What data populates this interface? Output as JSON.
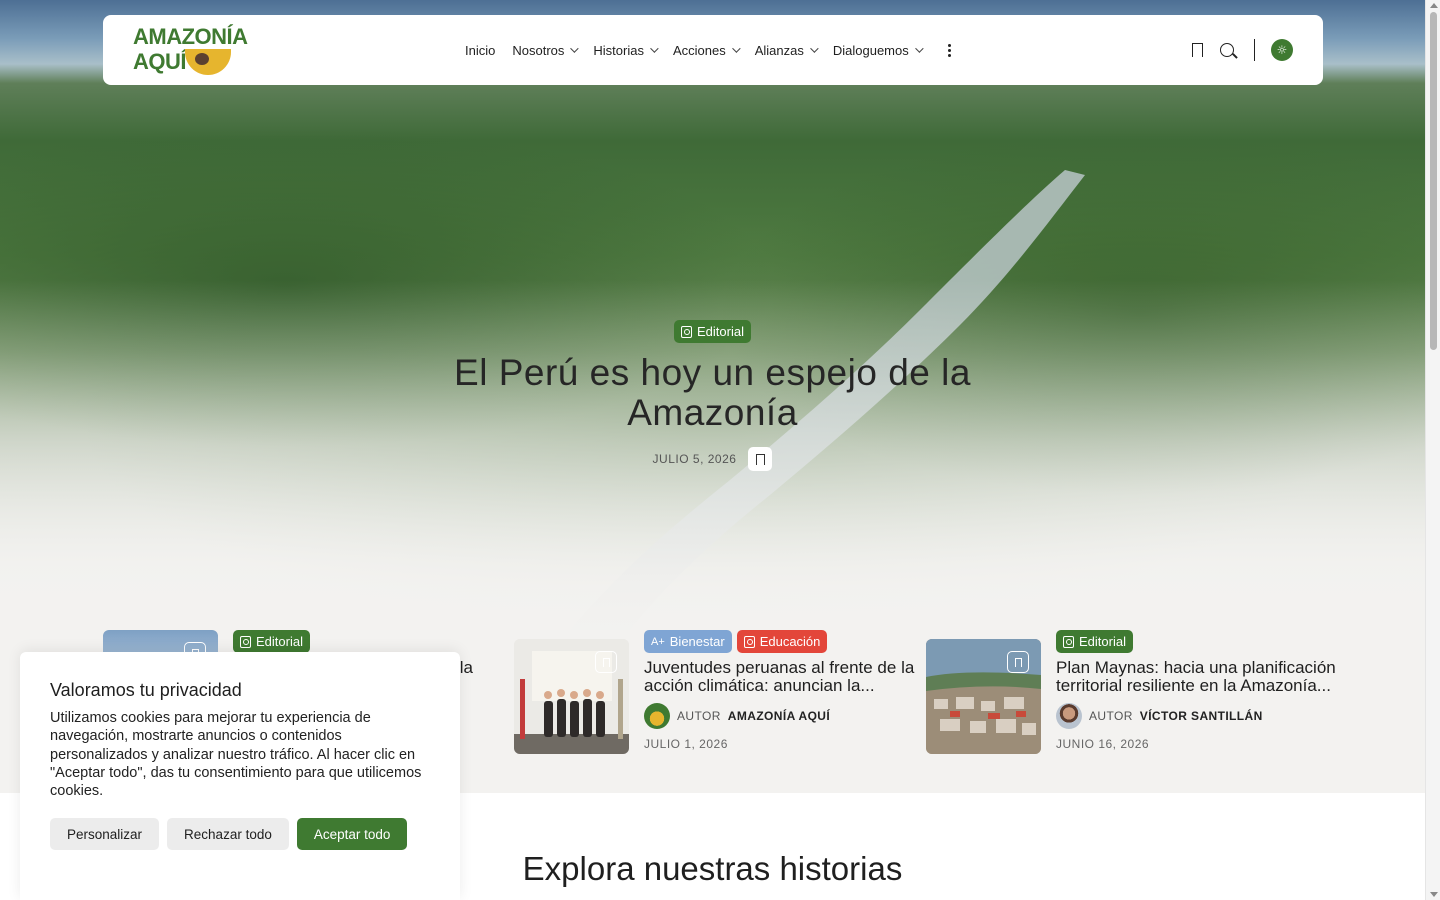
{
  "nav": {
    "logo_line1": "AMAZONÍA",
    "logo_line2": "AQUÍ",
    "items": [
      {
        "label": "Inicio",
        "has_dropdown": false
      },
      {
        "label": "Nosotros",
        "has_dropdown": true
      },
      {
        "label": "Historias",
        "has_dropdown": true
      },
      {
        "label": "Acciones",
        "has_dropdown": true
      },
      {
        "label": "Alianzas",
        "has_dropdown": true
      },
      {
        "label": "Dialoguemos",
        "has_dropdown": true
      }
    ],
    "icons": [
      "more-vertical-icon",
      "bookmark-icon",
      "search-icon",
      "sun-icon"
    ]
  },
  "hero": {
    "category": "Editorial",
    "title": "El Perú es hoy un espejo de la Amazonía",
    "date": "JULIO 5, 2026"
  },
  "cards": [
    {
      "tags": [
        {
          "label": "Editorial",
          "color": "#3f7a31"
        }
      ],
      "title_visible": "la"
    },
    {
      "tags": [
        {
          "label": "Bienestar",
          "color": "#7fa5d4"
        },
        {
          "label": "Educación",
          "color": "#e3463a"
        }
      ],
      "title": "Juventudes peruanas al frente de la acción climática: anuncian la...",
      "author_prefix": "AUTOR",
      "author": "AMAZONÍA AQUÍ",
      "date": "JULIO 1, 2026"
    },
    {
      "tags": [
        {
          "label": "Editorial",
          "color": "#3f7a31"
        }
      ],
      "title": "Plan Maynas: hacia una planificación territorial resiliente en la Amazonía...",
      "author_prefix": "AUTOR",
      "author": "VÍCTOR SANTILLÁN",
      "date": "JUNIO 16, 2026"
    }
  ],
  "section": {
    "title": "Explora nuestras historias"
  },
  "cookie": {
    "title": "Valoramos tu privacidad",
    "text": "Utilizamos cookies para mejorar tu experiencia de navegación, mostrarte anuncios o contenidos personalizados y analizar nuestro tráfico. Al hacer clic en \"Aceptar todo\", das tu consentimiento para que utilicemos cookies.",
    "btn_customize": "Personalizar",
    "btn_reject": "Rechazar todo",
    "btn_accept": "Aceptar todo"
  },
  "colors": {
    "brand_green": "#3f7a31",
    "tag_blue": "#7fa5d4",
    "tag_red": "#e3463a"
  }
}
